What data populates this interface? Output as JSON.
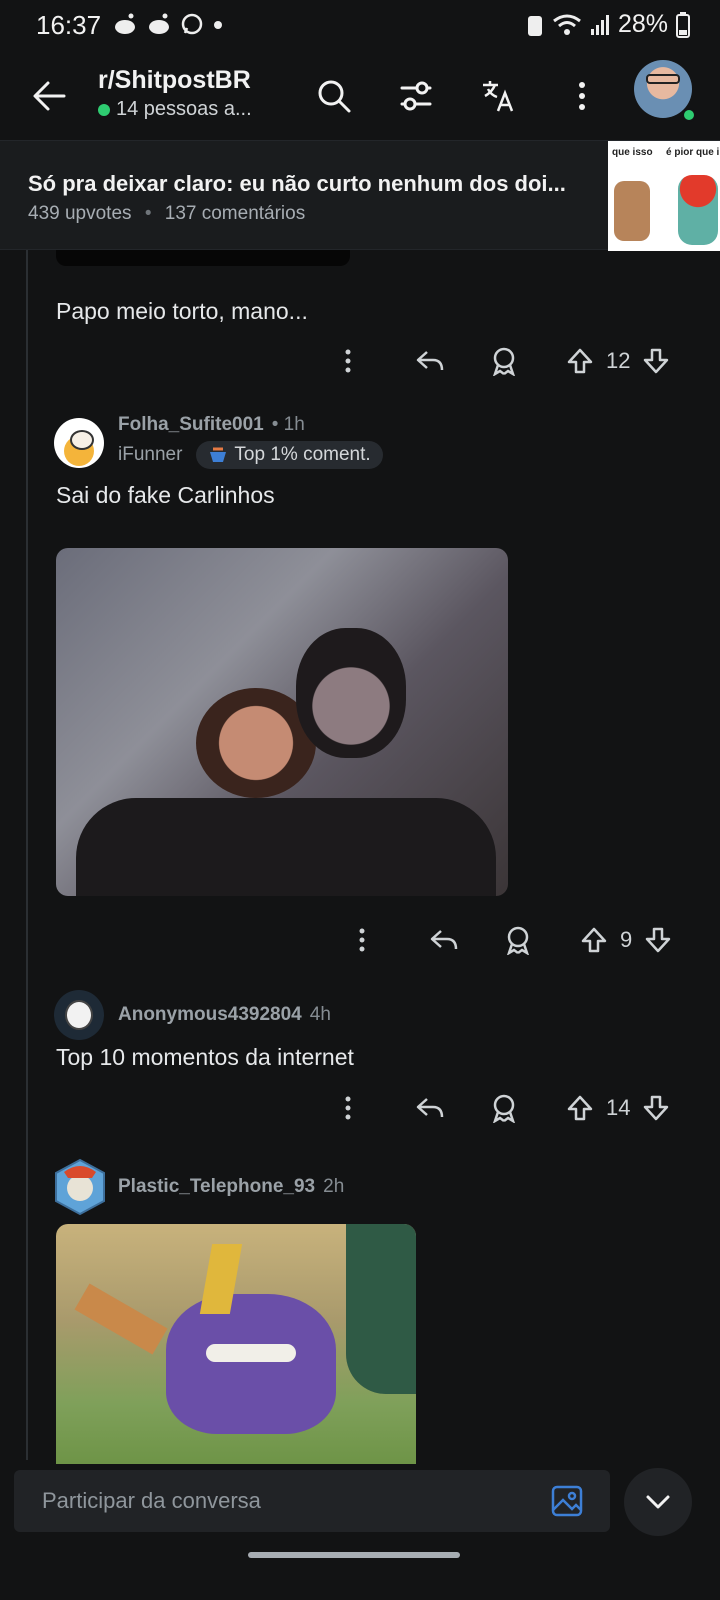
{
  "status_bar": {
    "time": "16:37",
    "battery": "28%"
  },
  "app_bar": {
    "subreddit": "r/ShitpostBR",
    "online": "14 pessoas a..."
  },
  "post": {
    "title": "Só pra deixar claro: eu não curto nenhum dos doi...",
    "upvotes": "439 upvotes",
    "separator": "•",
    "comments": "137 comentários",
    "thumb_left": "que isso",
    "thumb_right": "é pior que i"
  },
  "comments": [
    {
      "text": "Papo meio torto, mano...",
      "votes": "12"
    },
    {
      "user": "Folha_Sufite001",
      "time": "• 1h",
      "flair": "iFunner",
      "badge": "Top 1% coment.",
      "text": "Sai do fake Carlinhos",
      "votes": "9"
    },
    {
      "user": "Anonymous4392804",
      "time": "4h",
      "text": "Top 10 momentos da internet",
      "votes": "14"
    },
    {
      "user": "Plastic_Telephone_93",
      "time": "2h"
    }
  ],
  "composer": {
    "placeholder": "Participar da conversa"
  },
  "colors": {
    "background": "#121314",
    "online": "#2ecc71",
    "accent_icon": "#3d7fd6"
  }
}
